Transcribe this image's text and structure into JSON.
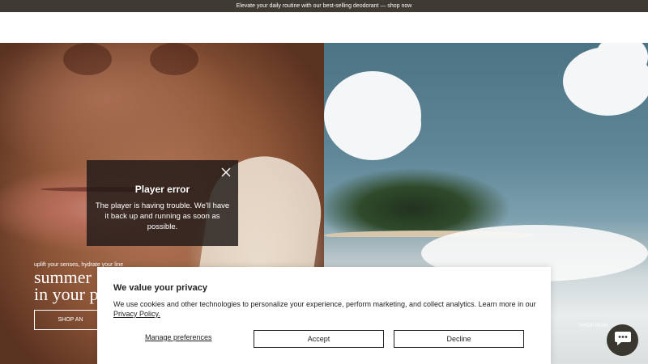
{
  "announcement": {
    "text": "Elevate your daily routine with our best-selling deodorant — shop now"
  },
  "hero_left": {
    "eyebrow": "uplift your senses, hydrate your line",
    "title_line1": "summer",
    "title_line2": "in your p",
    "button_label": "SHOP AN"
  },
  "hero_right": {
    "shop_now": "SHOP NOW"
  },
  "player_error": {
    "title": "Player error",
    "message": "The player is having trouble. We'll have it back up and running as soon as possible."
  },
  "cookie_banner": {
    "title": "We value your privacy",
    "text": "We use cookies and other technologies to personalize your experience, perform marketing, and collect analytics. Learn more in our ",
    "link_label": "Privacy Policy.",
    "manage_label": "Manage preferences",
    "accept_label": "Accept",
    "decline_label": "Decline"
  },
  "chat": {
    "icon": "chat-icon"
  },
  "colors": {
    "announcement_bg": "#3f3a33",
    "chat_bg": "#3a3630",
    "overlay_bg": "#1e1816"
  }
}
